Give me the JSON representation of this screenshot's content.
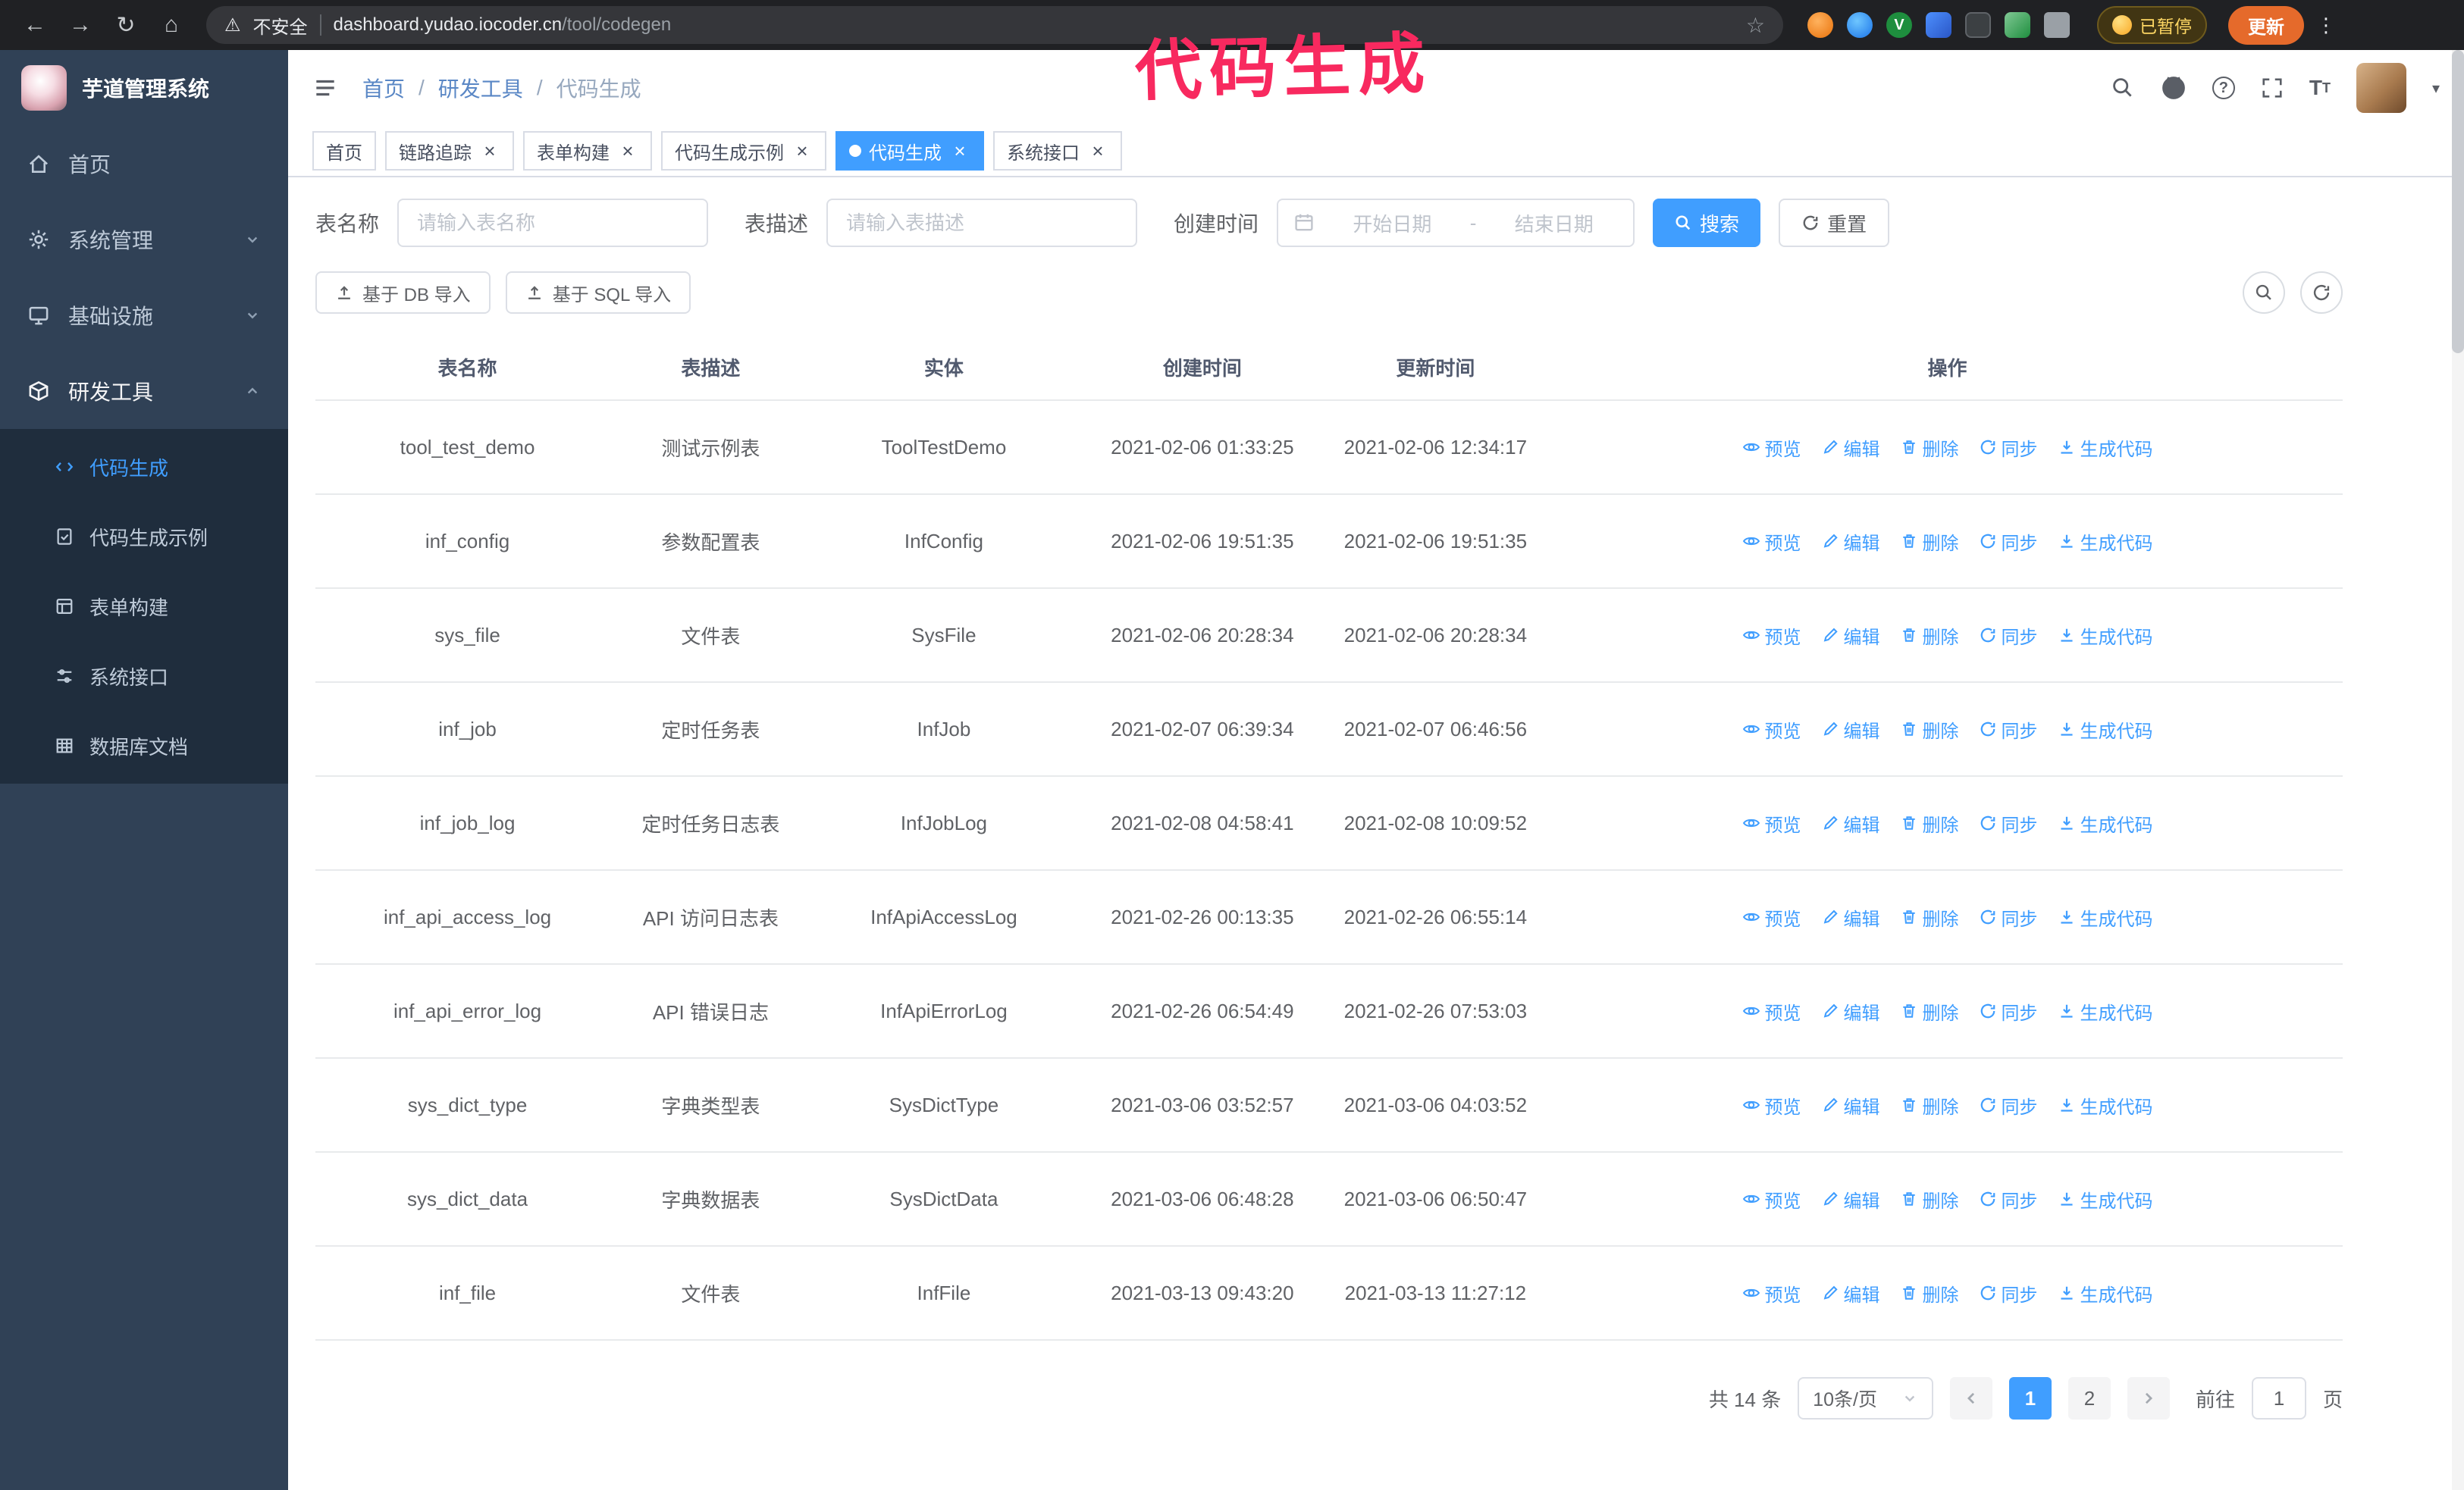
{
  "colors": {
    "accent": "#409eff",
    "annotation": "#f8295f",
    "update_badge": "#e56a2b",
    "sidebar_bg": "#304156",
    "submenu_bg": "#1f2d3d"
  },
  "annotation": "代码生成",
  "browser": {
    "security_warning": "不安全",
    "url_host": "dashboard.yudao.iocoder.cn",
    "url_path": "/tool/codegen",
    "paused_badge": "已暂停",
    "update_button": "更新"
  },
  "sidebar": {
    "title": "芋道管理系统",
    "items": [
      {
        "label": "首页"
      },
      {
        "label": "系统管理"
      },
      {
        "label": "基础设施"
      },
      {
        "label": "研发工具"
      }
    ],
    "submenu": [
      {
        "label": "代码生成",
        "active": true
      },
      {
        "label": "代码生成示例"
      },
      {
        "label": "表单构建"
      },
      {
        "label": "系统接口"
      },
      {
        "label": "数据库文档"
      }
    ]
  },
  "header": {
    "breadcrumb": [
      "首页",
      "研发工具",
      "代码生成"
    ],
    "separator": "/"
  },
  "tabs": [
    {
      "label": "首页",
      "closable": false,
      "active": false
    },
    {
      "label": "链路追踪",
      "closable": true,
      "active": false
    },
    {
      "label": "表单构建",
      "closable": true,
      "active": false
    },
    {
      "label": "代码生成示例",
      "closable": true,
      "active": false
    },
    {
      "label": "代码生成",
      "closable": true,
      "active": true
    },
    {
      "label": "系统接口",
      "closable": true,
      "active": false
    }
  ],
  "filters": {
    "table_name_label": "表名称",
    "table_name_placeholder": "请输入表名称",
    "table_desc_label": "表描述",
    "table_desc_placeholder": "请输入表描述",
    "create_time_label": "创建时间",
    "date_start_placeholder": "开始日期",
    "date_separator": "-",
    "date_end_placeholder": "结束日期",
    "search_button": "搜索",
    "reset_button": "重置"
  },
  "toolbar": {
    "import_db_button": "基于 DB 导入",
    "import_sql_button": "基于 SQL 导入"
  },
  "table": {
    "columns": [
      "表名称",
      "表描述",
      "实体",
      "创建时间",
      "更新时间",
      "操作"
    ],
    "action_labels": [
      "预览",
      "编辑",
      "删除",
      "同步",
      "生成代码"
    ],
    "rows": [
      {
        "name": "tool_test_demo",
        "desc": "测试示例表",
        "entity": "ToolTestDemo",
        "created": "2021-02-06 01:33:25",
        "updated": "2021-02-06 12:34:17"
      },
      {
        "name": "inf_config",
        "desc": "参数配置表",
        "entity": "InfConfig",
        "created": "2021-02-06 19:51:35",
        "updated": "2021-02-06 19:51:35"
      },
      {
        "name": "sys_file",
        "desc": "文件表",
        "entity": "SysFile",
        "created": "2021-02-06 20:28:34",
        "updated": "2021-02-06 20:28:34"
      },
      {
        "name": "inf_job",
        "desc": "定时任务表",
        "entity": "InfJob",
        "created": "2021-02-07 06:39:34",
        "updated": "2021-02-07 06:46:56"
      },
      {
        "name": "inf_job_log",
        "desc": "定时任务日志表",
        "entity": "InfJobLog",
        "created": "2021-02-08 04:58:41",
        "updated": "2021-02-08 10:09:52"
      },
      {
        "name": "inf_api_access_log",
        "desc": "API 访问日志表",
        "entity": "InfApiAccessLog",
        "created": "2021-02-26 00:13:35",
        "updated": "2021-02-26 06:55:14"
      },
      {
        "name": "inf_api_error_log",
        "desc": "API 错误日志",
        "entity": "InfApiErrorLog",
        "created": "2021-02-26 06:54:49",
        "updated": "2021-02-26 07:53:03"
      },
      {
        "name": "sys_dict_type",
        "desc": "字典类型表",
        "entity": "SysDictType",
        "created": "2021-03-06 03:52:57",
        "updated": "2021-03-06 04:03:52"
      },
      {
        "name": "sys_dict_data",
        "desc": "字典数据表",
        "entity": "SysDictData",
        "created": "2021-03-06 06:48:28",
        "updated": "2021-03-06 06:50:47"
      },
      {
        "name": "inf_file",
        "desc": "文件表",
        "entity": "InfFile",
        "created": "2021-03-13 09:43:20",
        "updated": "2021-03-13 11:27:12"
      }
    ]
  },
  "pagination": {
    "total": "共 14 条",
    "page_size": "10条/页",
    "pages": [
      "1",
      "2"
    ],
    "goto_label": "前往",
    "goto_value": "1",
    "goto_unit": "页"
  }
}
